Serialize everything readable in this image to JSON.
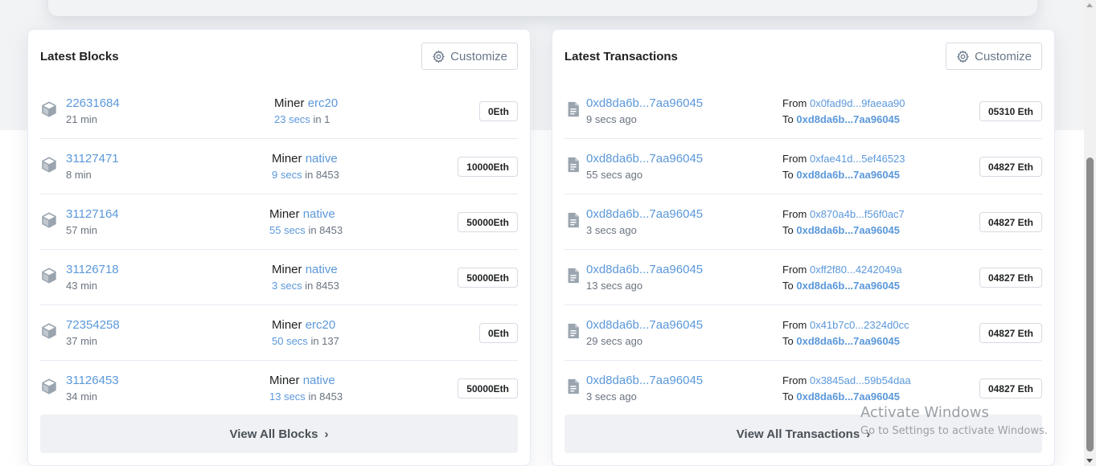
{
  "blocks_panel": {
    "title": "Latest Blocks",
    "customize_label": "Customize",
    "view_all_label": "View All Blocks",
    "rows": [
      {
        "block": "22631684",
        "age": "21 min",
        "miner_label": "Miner",
        "miner": "erc20",
        "time": "23 secs",
        "in_text": "in 1",
        "amount": "0Eth"
      },
      {
        "block": "31127471",
        "age": "8 min",
        "miner_label": "Miner",
        "miner": "native",
        "time": "9 secs",
        "in_text": "in 8453",
        "amount": "10000Eth"
      },
      {
        "block": "31127164",
        "age": "57 min",
        "miner_label": "Miner",
        "miner": "native",
        "time": "55 secs",
        "in_text": "in 8453",
        "amount": "50000Eth"
      },
      {
        "block": "31126718",
        "age": "43 min",
        "miner_label": "Miner",
        "miner": "native",
        "time": "3 secs",
        "in_text": "in 8453",
        "amount": "50000Eth"
      },
      {
        "block": "72354258",
        "age": "37 min",
        "miner_label": "Miner",
        "miner": "erc20",
        "time": "50 secs",
        "in_text": "in 137",
        "amount": "0Eth"
      },
      {
        "block": "31126453",
        "age": "34 min",
        "miner_label": "Miner",
        "miner": "native",
        "time": "13 secs",
        "in_text": "in 8453",
        "amount": "50000Eth"
      }
    ]
  },
  "transactions_panel": {
    "title": "Latest Transactions",
    "customize_label": "Customize",
    "view_all_label": "View All Transactions",
    "rows": [
      {
        "hash": "0xd8da6b...7aa96045",
        "age": "9 secs ago",
        "from_label": "From",
        "from": "0x0fad9d...9faeaa90",
        "to_label": "To",
        "to": "0xd8da6b...7aa96045",
        "amount": "05310 Eth"
      },
      {
        "hash": "0xd8da6b...7aa96045",
        "age": "55 secs ago",
        "from_label": "From",
        "from": "0xfae41d...5ef46523",
        "to_label": "To",
        "to": "0xd8da6b...7aa96045",
        "amount": "04827 Eth"
      },
      {
        "hash": "0xd8da6b...7aa96045",
        "age": "3 secs ago",
        "from_label": "From",
        "from": "0x870a4b...f56f0ac7",
        "to_label": "To",
        "to": "0xd8da6b...7aa96045",
        "amount": "04827 Eth"
      },
      {
        "hash": "0xd8da6b...7aa96045",
        "age": "13 secs ago",
        "from_label": "From",
        "from": "0xff2f80...4242049a",
        "to_label": "To",
        "to": "0xd8da6b...7aa96045",
        "amount": "04827 Eth"
      },
      {
        "hash": "0xd8da6b...7aa96045",
        "age": "29 secs ago",
        "from_label": "From",
        "from": "0x41b7c0...2324d0cc",
        "to_label": "To",
        "to": "0xd8da6b...7aa96045",
        "amount": "04827 Eth"
      },
      {
        "hash": "0xd8da6b...7aa96045",
        "age": "3 secs ago",
        "from_label": "From",
        "from": "0x3845ad...59b54daa",
        "to_label": "To",
        "to": "0xd8da6b...7aa96045",
        "amount": "04827 Eth"
      }
    ]
  },
  "watermark": {
    "line1": "Activate Windows",
    "line2": "Go to Settings to activate Windows."
  },
  "icons": {
    "block_row": "cube-icon",
    "tx_row": "document-icon",
    "customize": "gear-icon",
    "view_all": "chevron-right-icon"
  },
  "colors": {
    "link": "#5b98da",
    "page_band": "#f2f3f5",
    "view_all_bg": "#f0f1f4"
  }
}
